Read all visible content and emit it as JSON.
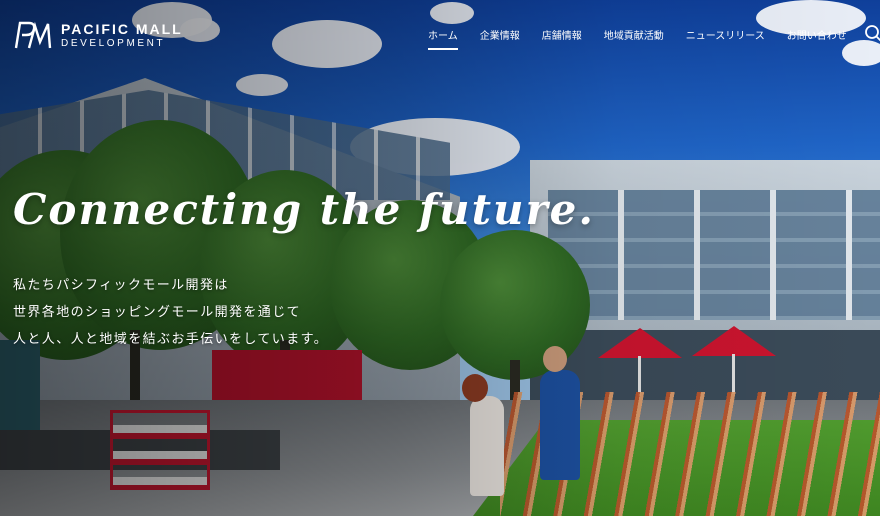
{
  "brand": {
    "logo_mark": "PM",
    "name_line1": "PACIFIC MALL",
    "name_line2": "DEVELOPMENT"
  },
  "nav": {
    "items": [
      {
        "label": "ホーム",
        "active": true
      },
      {
        "label": "企業情報",
        "active": false
      },
      {
        "label": "店舗情報",
        "active": false
      },
      {
        "label": "地域貢献活動",
        "active": false
      },
      {
        "label": "ニュースリリース",
        "active": false
      },
      {
        "label": "お問い合わせ",
        "active": false
      }
    ],
    "search_icon": "search-icon"
  },
  "hero": {
    "headline": "Connecting the future.",
    "lead_lines": [
      "私たちパシフィックモール開発は",
      "世界各地のショッピングモール開発を通じて",
      "人と人、人と地域を結ぶお手伝いをしています。"
    ]
  },
  "colors": {
    "text": "#ffffff",
    "sky": "#1f64c6",
    "accent_red": "#c9142e"
  }
}
